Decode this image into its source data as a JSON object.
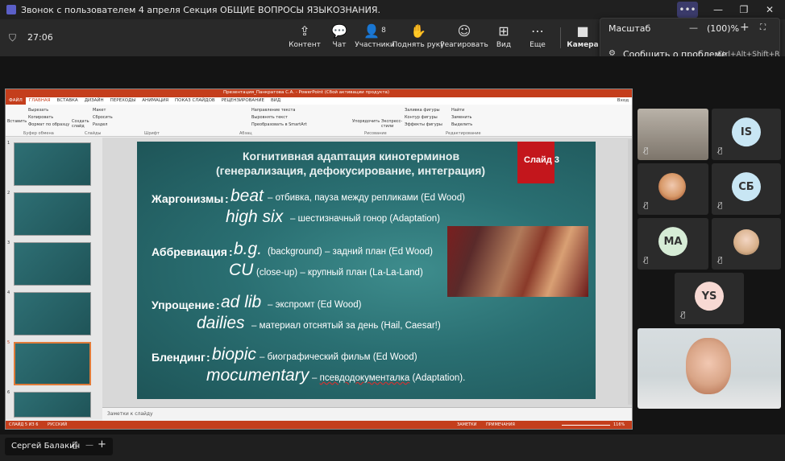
{
  "window": {
    "title": "Звонок с пользователем 4 апреля Секция ОБЩИЕ ВОПРОСЫ ЯЗЫКОЗНАНИЯ."
  },
  "toolbar": {
    "time": "27:06",
    "content": "Контент",
    "chat": "Чат",
    "participants": "Участники",
    "participants_count": "8",
    "raise_hand": "Поднять руку",
    "react": "Реагировать",
    "view": "Вид",
    "more": "Еще",
    "camera": "Камера"
  },
  "zoom": {
    "label": "Масштаб",
    "minus": "—",
    "value": "(100)%",
    "plus": "+",
    "report": "Сообщить о проблеме",
    "shortcut": "Ctrl+Alt+Shift+R"
  },
  "ppt": {
    "title": "Презентация_Панкратова С.А. - PowerPoint (Сбой активации продукта)",
    "tabs": [
      "ФАЙЛ",
      "ГЛАВНАЯ",
      "ВСТАВКА",
      "ДИЗАЙН",
      "ПЕРЕХОДЫ",
      "АНИМАЦИЯ",
      "ПОКАЗ СЛАЙДОВ",
      "РЕЦЕНЗИРОВАНИЕ",
      "ВИД"
    ],
    "login": "Вход",
    "ribbon": {
      "paste": "Вставить",
      "cut": "Вырезать",
      "copy": "Копировать",
      "format": "Формат по образцу",
      "clipboard": "Буфер обмена",
      "create": "Создать слайд",
      "layout": "Макет",
      "reset": "Сбросить",
      "section": "Раздел",
      "slides": "Слайды",
      "font": "Шрифт",
      "paragraph": "Абзац",
      "text_dir": "Направление текста",
      "align_text": "Выровнять текст",
      "smartart": "Преобразовать в SmartArt",
      "drawing": "Рисование",
      "arrange": "Упорядочить",
      "express": "Экспресс-стили",
      "fill": "Заливка фигуры",
      "outline": "Контур фигуры",
      "effects": "Эффекты фигуры",
      "find": "Найти",
      "replace": "Заменить",
      "select": "Выделить",
      "editing": "Редактирование"
    },
    "thumb_numbers": [
      "1",
      "2",
      "3",
      "4",
      "5",
      "6"
    ],
    "notes": "Заметки к слайду",
    "status": {
      "slide": "СЛАЙД 5 ИЗ 6",
      "lang": "РУССКИЙ",
      "notes": "ЗАМЕТКИ",
      "comments": "ПРИМЕЧАНИЯ",
      "zoom": "116%"
    }
  },
  "slide": {
    "title1": "Когнитивная адаптация кинотерминов",
    "title2": "(генерализация, дефокусирование, интеграция)",
    "badge": "Слайд 3",
    "l1a": "Жаргонизмы",
    "l1b": "beat",
    "l1c": "– отбивка, пауза между репликами (Ed Wood)",
    "l2b": "high six",
    "l2c": "– шестизначный гонор (Adaptation)",
    "l3a": "Аббревиация",
    "l3b": "b.g.",
    "l3c": "(background) – задний план (Ed Wood)",
    "l4b": "CU",
    "l4c": "(close-up) – крупный план (La-La-Land)",
    "l5a": "Упрощение",
    "l5b": "ad lib",
    "l5c": "– экспромт (Ed Wood)",
    "l6b": "dailies",
    "l6c": "– материал отснятый за день (Hail, Caesar!)",
    "l7a": "Блендинг",
    "l7b": "biopic",
    "l7c": "– биографический фильм (Ed Wood)",
    "l8b": "mocumentary",
    "l8c1": "– ",
    "l8c2": "псевдодокументалка",
    "l8c3": " (Adaptation)."
  },
  "participants": [
    {
      "initials": "IS",
      "color": "#c8e6f4"
    },
    {
      "initials": "СБ",
      "color": "#c8e6f4"
    },
    {
      "initials": "MA",
      "color": "#d6ecd6"
    },
    {
      "initials": "YS",
      "color": "#f7d9d3"
    }
  ],
  "bottom": {
    "presenter": "Сергей Балакин"
  }
}
